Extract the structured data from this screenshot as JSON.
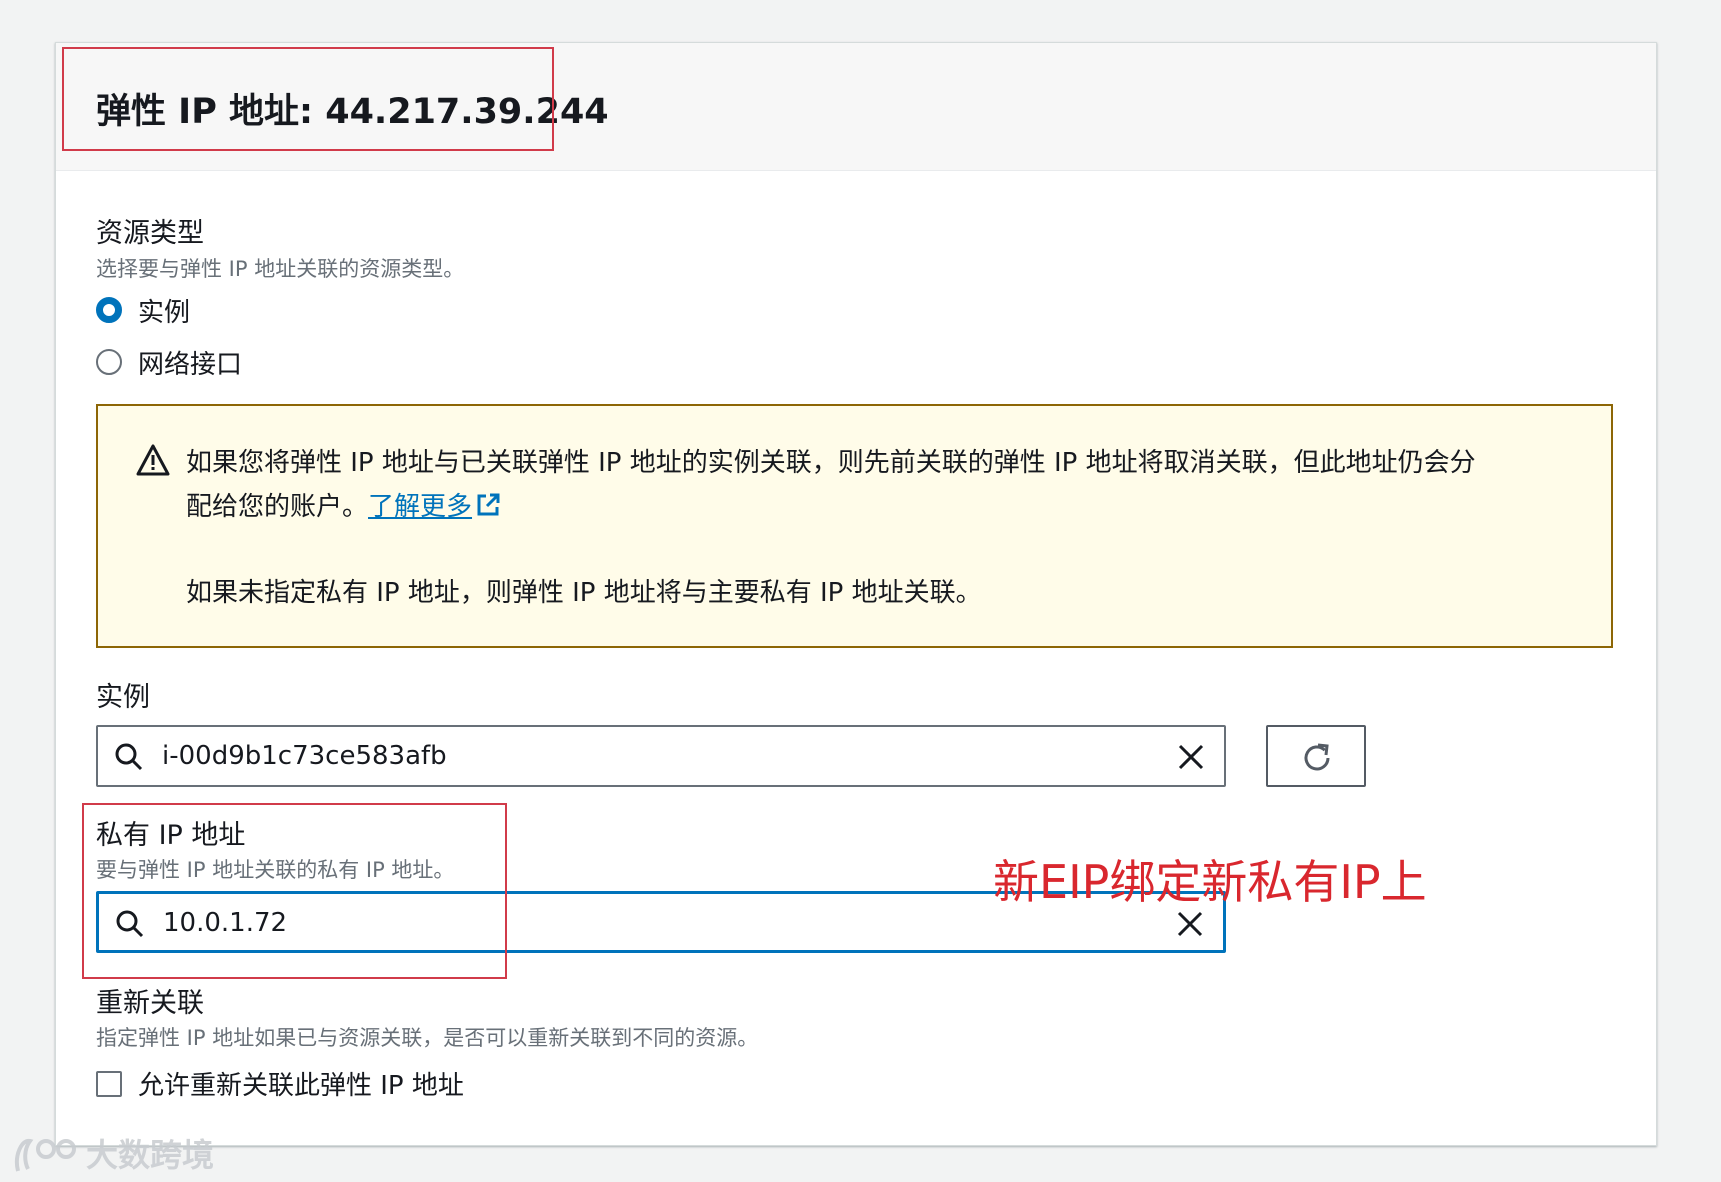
{
  "header": {
    "title": "弹性 IP 地址: 44.217.39.244"
  },
  "resource_type": {
    "label": "资源类型",
    "description": "选择要与弹性 IP 地址关联的资源类型。",
    "options": [
      {
        "label": "实例",
        "checked": true
      },
      {
        "label": "网络接口",
        "checked": false
      }
    ]
  },
  "alert": {
    "line1": "如果您将弹性 IP 地址与已关联弹性 IP 地址的实例关联，则先前关联的弹性 IP 地址将取消关联，但此地址仍会分",
    "line2_prefix": "配给您的账户。",
    "link": "了解更多",
    "line3": "如果未指定私有 IP 地址，则弹性 IP 地址将与主要私有 IP 地址关联。",
    "icon": "warning-icon"
  },
  "instance": {
    "label": "实例",
    "value": "i-00d9b1c73ce583afb",
    "refresh_icon": "refresh-icon"
  },
  "private_ip": {
    "label": "私有 IP 地址",
    "description": "要与弹性 IP 地址关联的私有 IP 地址。",
    "value": "10.0.1.72"
  },
  "annotation": {
    "text": "新EIP绑定新私有IP上",
    "color": "#d9272e"
  },
  "reassociation": {
    "label": "重新关联",
    "description": "指定弹性 IP 地址如果已与资源关联，是否可以重新关联到不同的资源。",
    "checkbox_label": "允许重新关联此弹性 IP 地址",
    "checked": false
  },
  "watermark": {
    "text": "大数跨境"
  },
  "colors": {
    "accent": "#0073bb",
    "warning_border": "#8d6605",
    "warning_bg": "#fffce9",
    "annotation_box": "#d13b4a"
  }
}
